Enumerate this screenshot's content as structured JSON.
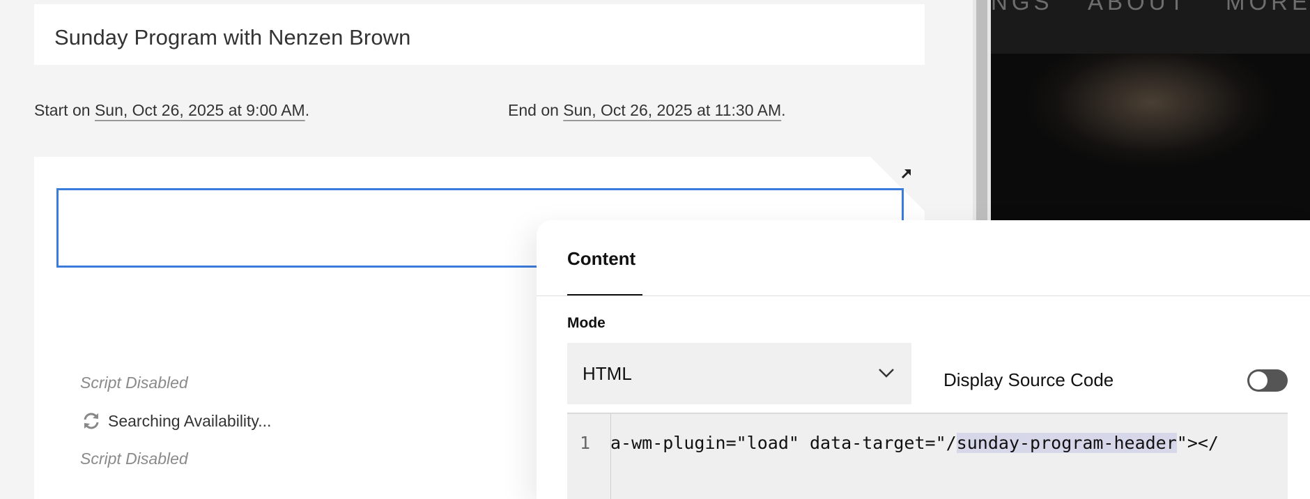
{
  "event": {
    "title": "Sunday Program with Nenzen Brown",
    "start_prefix": "Start on ",
    "start_value": "Sun, Oct 26, 2025 at 9:00 AM",
    "end_prefix": "End on ",
    "end_value": "Sun, Oct 26, 2025 at 11:30 AM",
    "period": "."
  },
  "block": {
    "script_disabled_1": "Script Disabled",
    "searching": "Searching Availability...",
    "script_disabled_2": "Script Disabled"
  },
  "preview": {
    "nav": [
      "NGS",
      "ABOUT",
      "MORE"
    ]
  },
  "panel": {
    "tab_label": "Content",
    "mode_label": "Mode",
    "mode_value": "HTML",
    "display_source_label": "Display Source Code",
    "display_source_on": false,
    "code_line_number": "1",
    "code_before": "a-wm-plugin=\"load\" data-target=\"/",
    "code_highlight": "sunday-program-header",
    "code_after": "\"></"
  },
  "colors": {
    "accent": "#3a7bdc",
    "toggle_off": "#555555"
  }
}
